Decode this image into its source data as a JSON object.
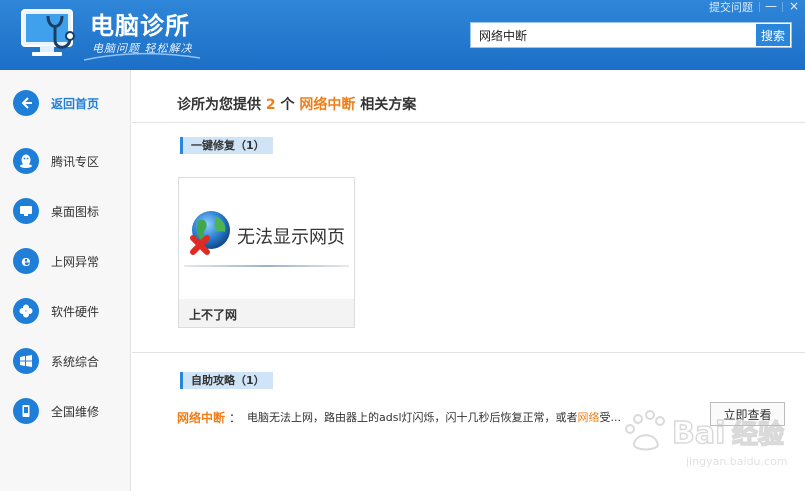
{
  "header": {
    "app_title": "电脑诊所",
    "slogan": "电脑问题 轻松解决",
    "top_link": "提交问题",
    "minimize": "—",
    "close": "×",
    "search": {
      "value": "网络中断",
      "button": "搜索"
    }
  },
  "sidebar": {
    "items": [
      {
        "label": "返回首页",
        "icon": "back-arrow-icon"
      },
      {
        "label": "腾讯专区",
        "icon": "penguin-icon"
      },
      {
        "label": "桌面图标",
        "icon": "monitor-icon"
      },
      {
        "label": "上网异常",
        "icon": "ie-icon"
      },
      {
        "label": "软件硬件",
        "icon": "clover-icon"
      },
      {
        "label": "系统综合",
        "icon": "windows-icon"
      },
      {
        "label": "全国维修",
        "icon": "phone-icon"
      }
    ]
  },
  "main": {
    "title_prefix": "诊所为您提供",
    "count": "2",
    "unit": "个",
    "keyword": "网络中断",
    "title_suffix": "相关方案",
    "section_fix": "一键修复（1）",
    "card": {
      "image_text": "无法显示网页",
      "caption": "上不了网"
    },
    "section_guide": "自助攻略（1）",
    "guide": {
      "key": "网络中断",
      "sep": "：",
      "text_before": "电脑无法上网，路由器上的adsl灯闪烁，闪十几秒后恢复正常，或者",
      "text_hl": "网络",
      "text_after": "受...",
      "button": "立即查看"
    }
  },
  "watermark": {
    "text": "jingyan.baidu.com"
  },
  "colors": {
    "header_blue": "#1f7fd8",
    "highlight_orange": "#f07e1a"
  }
}
